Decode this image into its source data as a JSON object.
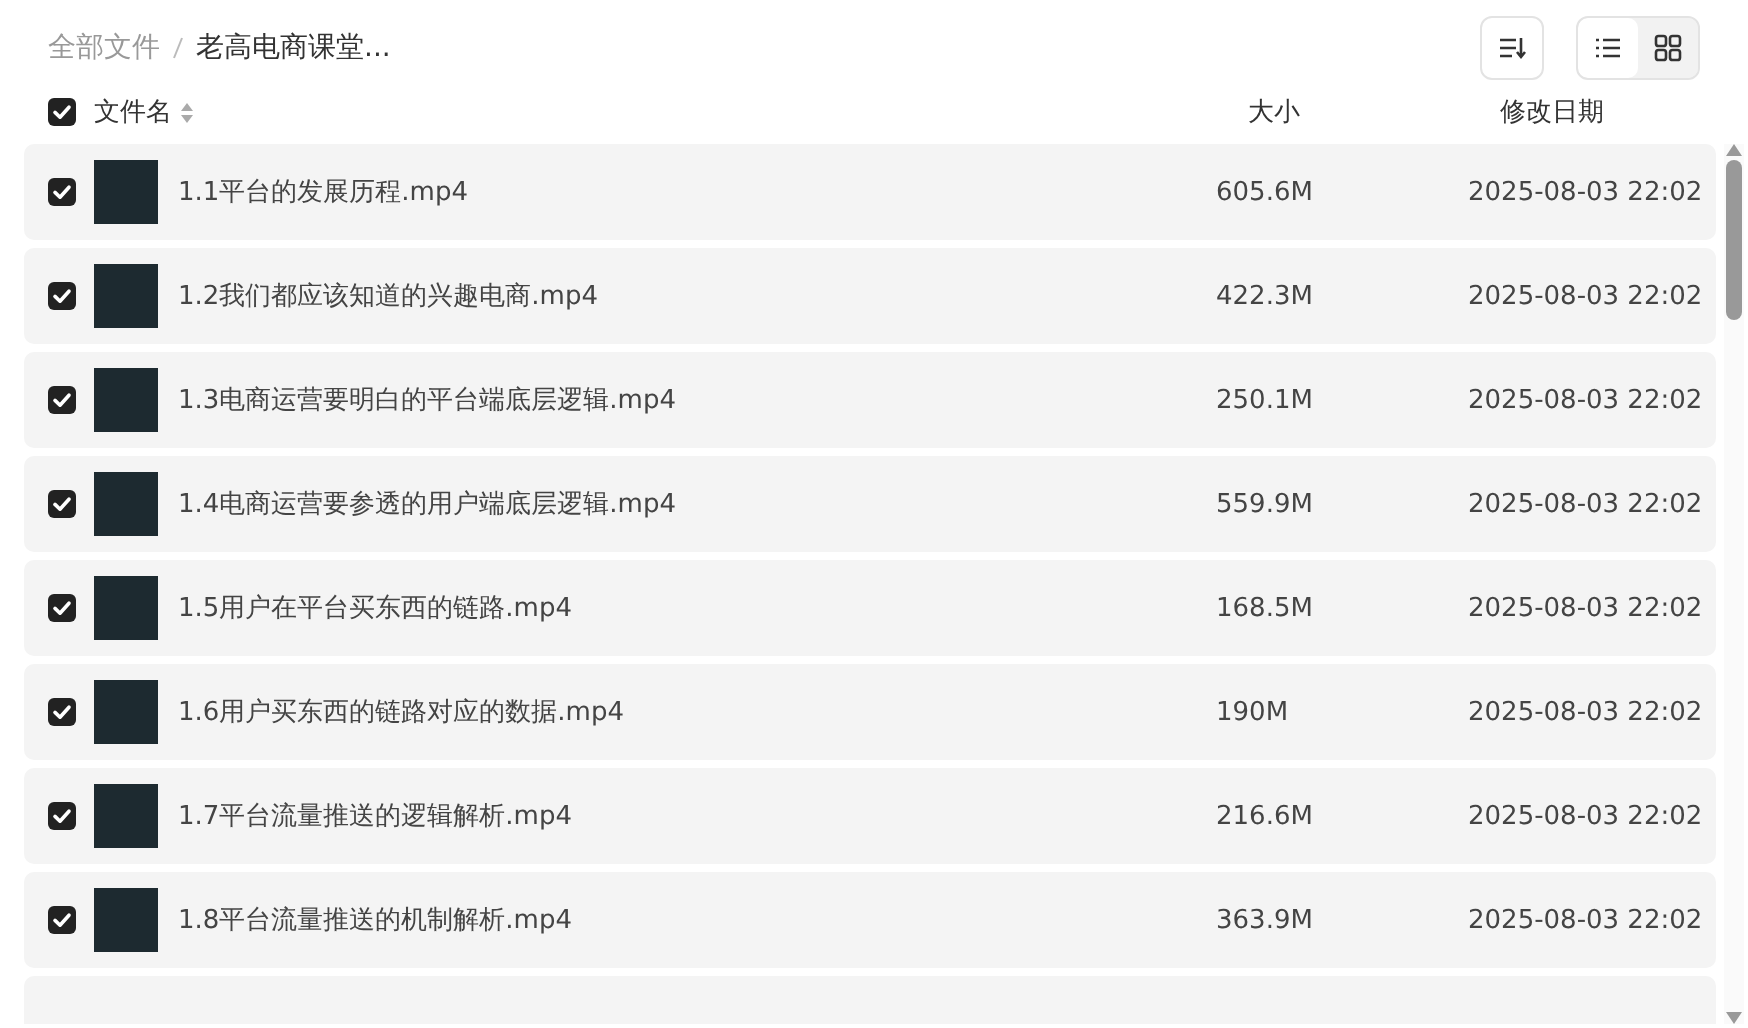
{
  "breadcrumb": [
    {
      "label": "全部文件",
      "current": false
    },
    {
      "label": "老高电商课堂...",
      "current": true
    }
  ],
  "view_buttons": [
    {
      "kind": "list",
      "selected": true
    },
    {
      "kind": "grid",
      "selected": false
    }
  ],
  "header": {
    "select_all_checked": true,
    "name": "文件名",
    "size": "大小",
    "date": "修改日期"
  },
  "files": [
    {
      "name": "1.1平台的发展历程.mp4",
      "size": "605.6M",
      "date": "2025-08-03 22:02",
      "checked": true
    },
    {
      "name": "1.2我们都应该知道的兴趣电商.mp4",
      "size": "422.3M",
      "date": "2025-08-03 22:02",
      "checked": true
    },
    {
      "name": "1.3电商运营要明白的平台端底层逻辑.mp4",
      "size": "250.1M",
      "date": "2025-08-03 22:02",
      "checked": true
    },
    {
      "name": "1.4电商运营要参透的用户端底层逻辑.mp4",
      "size": "559.9M",
      "date": "2025-08-03 22:02",
      "checked": true
    },
    {
      "name": "1.5用户在平台买东西的链路.mp4",
      "size": "168.5M",
      "date": "2025-08-03 22:02",
      "checked": true
    },
    {
      "name": "1.6用户买东西的链路对应的数据.mp4",
      "size": "190M",
      "date": "2025-08-03 22:02",
      "checked": true
    },
    {
      "name": "1.7平台流量推送的逻辑解析.mp4",
      "size": "216.6M",
      "date": "2025-08-03 22:02",
      "checked": true
    },
    {
      "name": "1.8平台流量推送的机制解析.mp4",
      "size": "363.9M",
      "date": "2025-08-03 22:02",
      "checked": true
    }
  ]
}
